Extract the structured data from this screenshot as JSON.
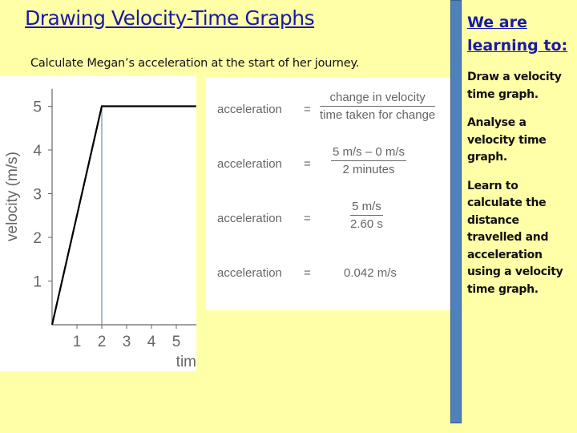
{
  "slide": {
    "title": "Drawing Velocity-Time Graphs",
    "question": "Calculate Megan’s acceleration at the start of her journey."
  },
  "chart_data": {
    "type": "line",
    "ylabel": "velocity (m/s)",
    "xlabel": "tim",
    "x_ticks": [
      "1",
      "2",
      "3",
      "4",
      "5"
    ],
    "y_ticks": [
      "1",
      "2",
      "3",
      "4",
      "5"
    ],
    "x": [
      0,
      2,
      5.8
    ],
    "y": [
      0,
      5,
      5
    ],
    "marker_line_x": 2,
    "xlim": [
      0,
      5.8
    ],
    "ylim": [
      0,
      5.5
    ]
  },
  "equations": [
    {
      "label": "acceleration",
      "equals": "=",
      "numerator": "change in velocity",
      "denominator": "time taken for change"
    },
    {
      "label": "acceleration",
      "equals": "=",
      "numerator": "5 m/s – 0 m/s",
      "denominator": "2 minutes"
    },
    {
      "label": "acceleration",
      "equals": "=",
      "numerator": "5 m/s",
      "denominator": "2.60 s"
    },
    {
      "label": "acceleration",
      "equals": "=",
      "value": "0.042 m/s"
    }
  ],
  "objectives": {
    "heading": "We are learning to:",
    "items": [
      "Draw a velocity time graph.",
      "Analyse a velocity time graph.",
      "Learn to calculate the distance travelled and acceleration using a velocity time graph."
    ]
  },
  "colors": {
    "background": "#ffffa8",
    "accent_bar": "#4f81bd",
    "heading": "#1a1aa6"
  }
}
